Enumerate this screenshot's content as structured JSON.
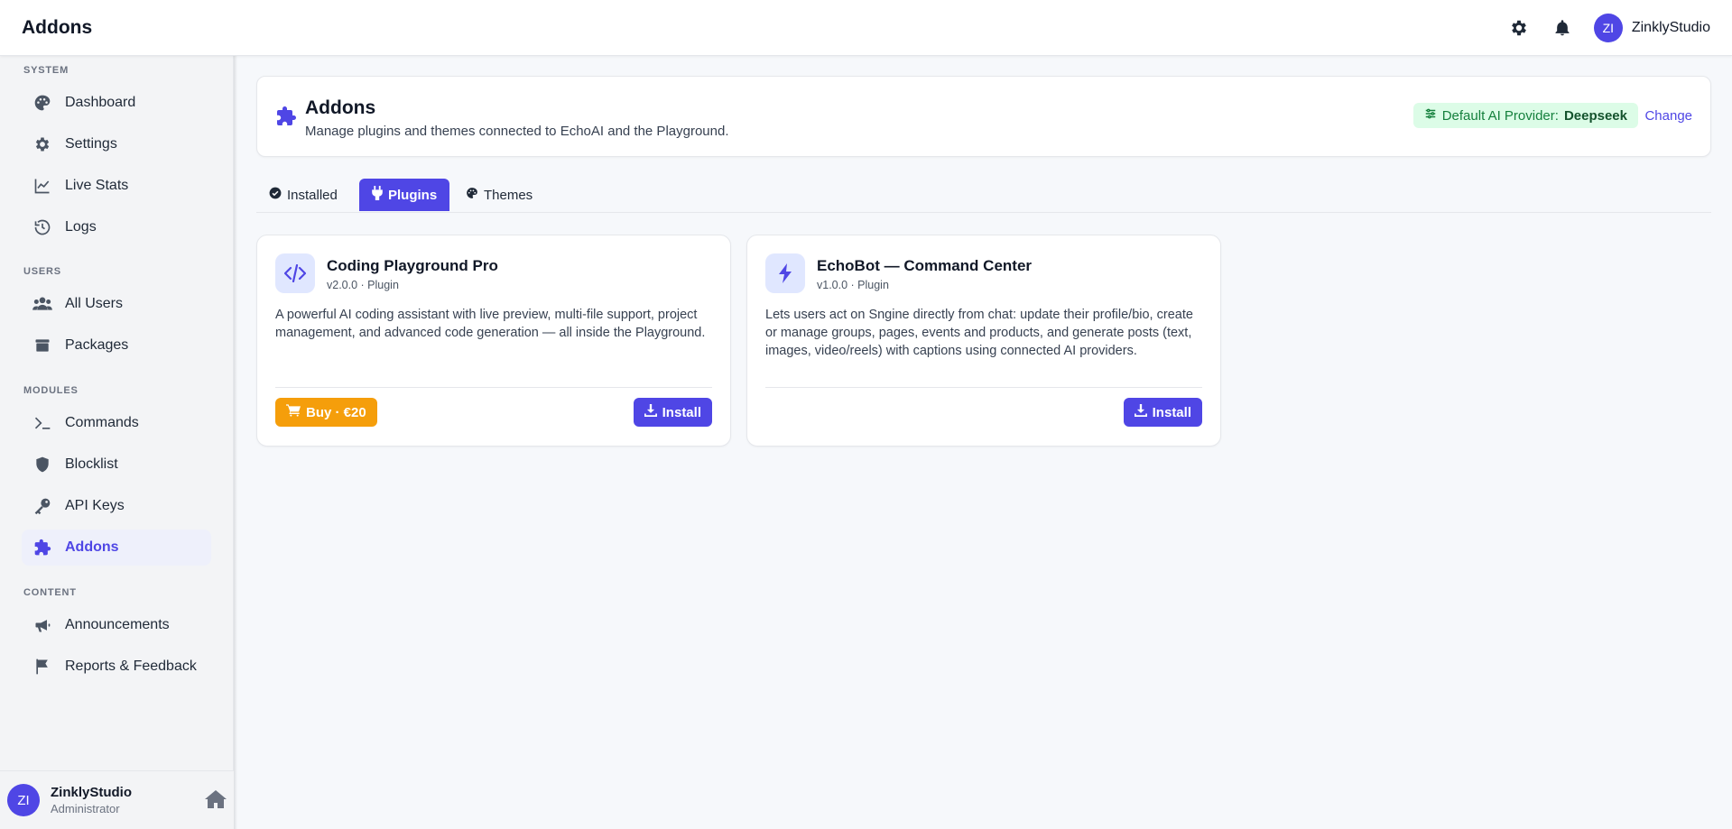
{
  "topbar": {
    "title": "Addons",
    "user_initials": "ZI",
    "user_name": "ZinklyStudio",
    "icons": [
      "gear-icon",
      "bell-icon"
    ]
  },
  "sidebar": {
    "sections": {
      "system": "SYSTEM",
      "users": "USERS",
      "modules": "MODULES",
      "content": "CONTENT"
    },
    "items": [
      {
        "label": "Dashboard",
        "icon": "palette-icon"
      },
      {
        "label": "Settings",
        "icon": "gear-icon"
      },
      {
        "label": "Live Stats",
        "icon": "chart-line-icon"
      },
      {
        "label": "Logs",
        "icon": "history-icon"
      },
      {
        "label": "All Users",
        "icon": "users-icon"
      },
      {
        "label": "Packages",
        "icon": "box-icon"
      },
      {
        "label": "Commands",
        "icon": "terminal-icon"
      },
      {
        "label": "Blocklist",
        "icon": "shield-icon"
      },
      {
        "label": "API Keys",
        "icon": "key-icon"
      },
      {
        "label": "Addons",
        "icon": "puzzle-icon",
        "active": true
      },
      {
        "label": "Announcements",
        "icon": "megaphone-icon"
      },
      {
        "label": "Reports & Feedback",
        "icon": "flag-icon"
      }
    ],
    "footer": {
      "initials": "ZI",
      "name": "ZinklyStudio",
      "role": "Administrator"
    }
  },
  "header": {
    "title": "Addons",
    "subtitle": "Manage plugins and themes connected to EchoAI and the Playground.",
    "provider_label": "Default AI Provider:",
    "provider_value": "Deepseek",
    "change_label": "Change"
  },
  "tabs": [
    {
      "label": "Installed",
      "icon": "check-circle-icon"
    },
    {
      "label": "Plugins",
      "icon": "plug-icon",
      "active": true
    },
    {
      "label": "Themes",
      "icon": "palette-icon"
    }
  ],
  "cards": [
    {
      "title": "Coding Playground Pro",
      "meta": "v2.0.0 · Plugin",
      "description": "A powerful AI coding assistant with live preview, multi-file support, project management, and advanced code generation — all inside the Playground.",
      "buy_label": "Buy · €20",
      "install_label": "Install",
      "icon": "code-icon"
    },
    {
      "title": "EchoBot — Command Center",
      "meta": "v1.0.0 · Plugin",
      "description": "Lets users act on Sngine directly from chat: update their profile/bio, create or manage groups, pages, events and products, and generate posts (text, images, video/reels) with captions using connected AI providers.",
      "install_label": "Install",
      "icon": "bolt-icon"
    }
  ],
  "colors": {
    "accent": "#4f46e5",
    "buy": "#f59e0b",
    "provider_bg": "#dcfce7",
    "provider_text": "#15803d"
  }
}
